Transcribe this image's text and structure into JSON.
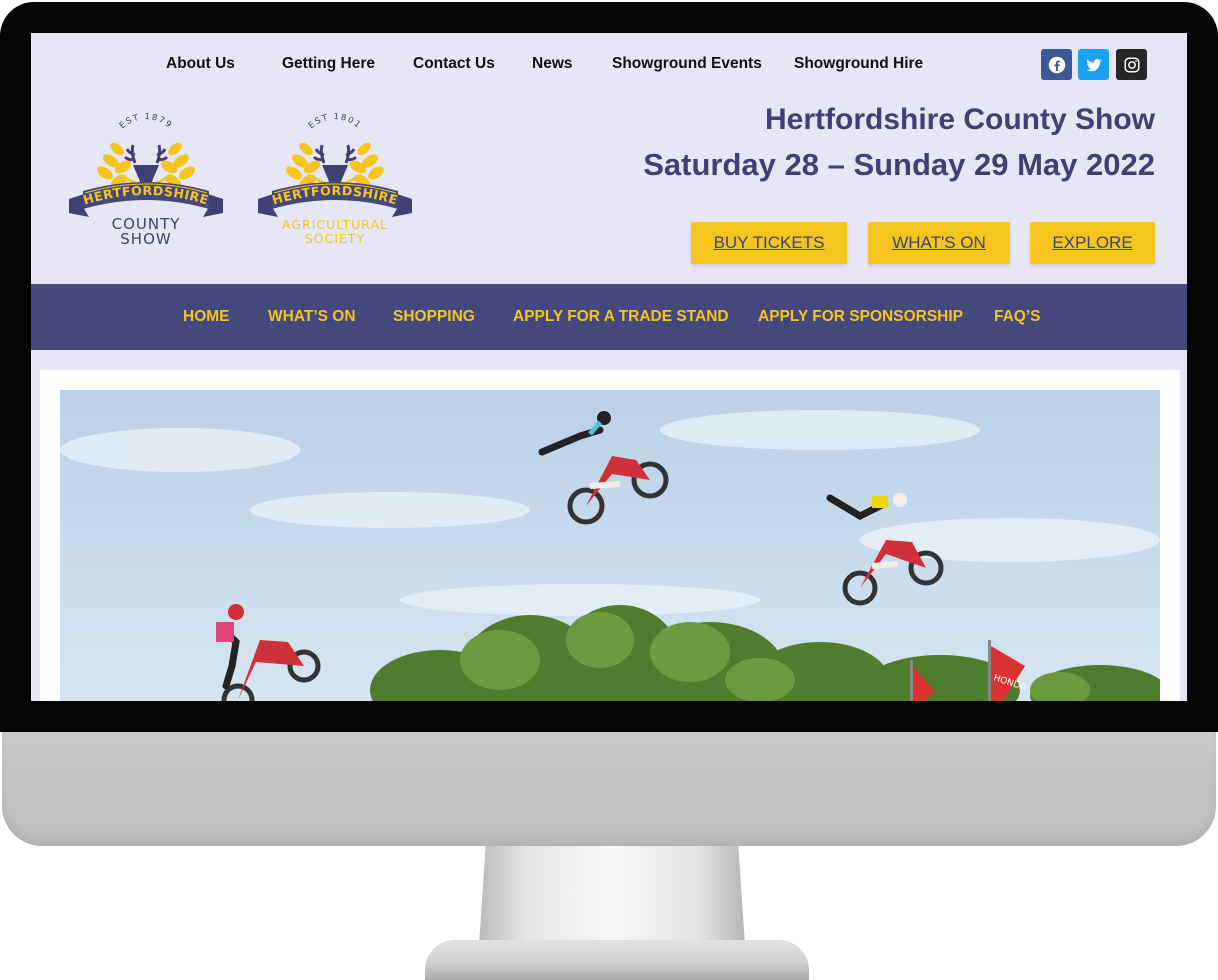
{
  "top_nav": {
    "items": [
      "About Us",
      "Getting Here",
      "Contact Us",
      "News",
      "Showground Events",
      "Showground Hire"
    ]
  },
  "social": {
    "items": [
      {
        "icon": "facebook-icon",
        "color": "#3b5998"
      },
      {
        "icon": "twitter-icon",
        "color": "#1da1f2"
      },
      {
        "icon": "instagram-icon",
        "color": "#262626"
      }
    ]
  },
  "logos": {
    "county_show": {
      "est": "EST 1879",
      "banner": "HERTFORDSHIRE",
      "line1": "COUNTY",
      "line2": "SHOW"
    },
    "agricultural_society": {
      "est": "EST 1801",
      "banner": "HERTFORDSHIRE",
      "line1": "AGRICULTURAL",
      "line2": "SOCIETY"
    }
  },
  "header": {
    "title": "Hertfordshire County Show",
    "dates": "Saturday 28 – Sunday 29 May 2022"
  },
  "cta_buttons": [
    "BUY TICKETS",
    "WHAT'S ON",
    "EXPLORE"
  ],
  "main_nav": {
    "items": [
      "HOME",
      "WHAT’S ON",
      "SHOPPING",
      "APPLY FOR A TRADE STAND",
      "APPLY FOR SPONSORSHIP",
      "FAQ’S"
    ]
  },
  "hero": {
    "flag_text": "HONDA"
  },
  "colors": {
    "page_bg": "#e7e6f5",
    "brand_navy": "#45487a",
    "title_navy": "#3f4073",
    "accent_yellow": "#f4c51f"
  }
}
